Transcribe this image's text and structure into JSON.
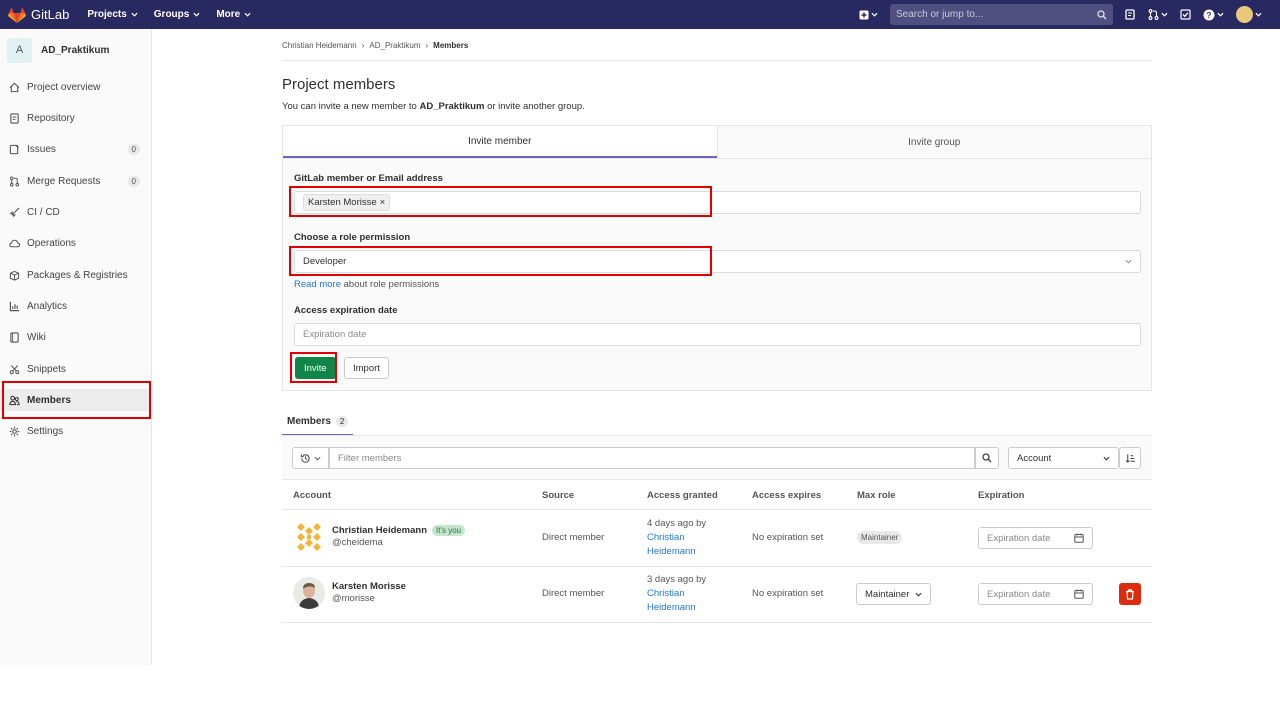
{
  "topbar": {
    "brand": "GitLab",
    "menus": [
      "Projects",
      "Groups",
      "More"
    ],
    "search_placeholder": "Search or jump to..."
  },
  "sidebar": {
    "project_initial": "A",
    "project_name": "AD_Praktikum",
    "items": [
      {
        "label": "Project overview",
        "icon": "home-icon"
      },
      {
        "label": "Repository",
        "icon": "document-icon"
      },
      {
        "label": "Issues",
        "icon": "issues-icon",
        "count": "0"
      },
      {
        "label": "Merge Requests",
        "icon": "merge-request-icon",
        "count": "0"
      },
      {
        "label": "CI / CD",
        "icon": "rocket-icon"
      },
      {
        "label": "Operations",
        "icon": "cloud-gear-icon"
      },
      {
        "label": "Packages & Registries",
        "icon": "package-icon"
      },
      {
        "label": "Analytics",
        "icon": "chart-icon"
      },
      {
        "label": "Wiki",
        "icon": "book-icon"
      },
      {
        "label": "Snippets",
        "icon": "scissors-icon"
      },
      {
        "label": "Members",
        "icon": "users-icon",
        "active": true
      },
      {
        "label": "Settings",
        "icon": "gear-icon"
      }
    ]
  },
  "breadcrumb": [
    "Christian Heidemann",
    "AD_Praktikum",
    "Members"
  ],
  "page": {
    "title": "Project members",
    "desc_prefix": "You can invite a new member to ",
    "desc_project": "AD_Praktikum",
    "desc_suffix": " or invite another group."
  },
  "invite": {
    "tabs": [
      "Invite member",
      "Invite group"
    ],
    "member_label": "GitLab member or Email address",
    "member_token": "Karsten Morisse",
    "role_label": "Choose a role permission",
    "role_value": "Developer",
    "read_more_link": "Read more",
    "read_more_suffix": " about role permissions",
    "expiration_label": "Access expiration date",
    "expiration_placeholder": "Expiration date",
    "invite_button": "Invite",
    "import_button": "Import"
  },
  "members_tab": {
    "label": "Members",
    "count": "2"
  },
  "filter": {
    "placeholder": "Filter members",
    "sort_value": "Account"
  },
  "table": {
    "columns": [
      "Account",
      "Source",
      "Access granted",
      "Access expires",
      "Max role",
      "Expiration"
    ],
    "rows": [
      {
        "name": "Christian Heidemann",
        "badge": "It's you",
        "username": "@cheidema",
        "source": "Direct member",
        "granted_time": "4 days ago by",
        "granted_by_1": "Christian",
        "granted_by_2": "Heidemann",
        "expires": "No expiration set",
        "role": "Maintainer",
        "expiration_placeholder": "Expiration date"
      },
      {
        "name": "Karsten Morisse",
        "username": "@morisse",
        "source": "Direct member",
        "granted_time": "3 days ago by",
        "granted_by_1": "Christian",
        "granted_by_2": "Heidemann",
        "expires": "No expiration set",
        "role": "Maintainer",
        "expiration_placeholder": "Expiration date"
      }
    ]
  },
  "colors": {
    "navbar": "#292961",
    "accent": "#6666c4",
    "invite_button": "#108548",
    "delete_button": "#dd2b0e",
    "highlight_box": "#e00000"
  }
}
